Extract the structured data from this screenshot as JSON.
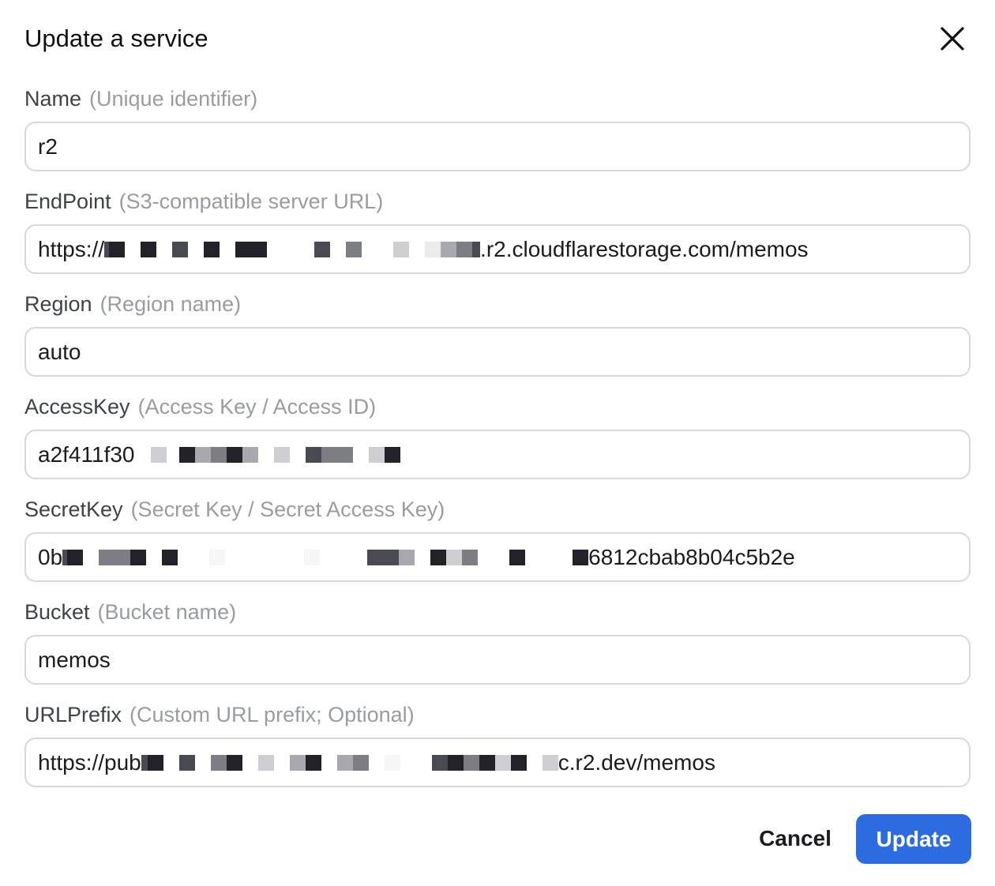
{
  "dialog": {
    "title": "Update a service",
    "close_icon": "close-icon"
  },
  "fields": {
    "name": {
      "label": "Name",
      "hint": "(Unique identifier)",
      "value": "r2"
    },
    "endpoint": {
      "label": "EndPoint",
      "hint": "(S3-compatible server URL)",
      "value_start": "https://",
      "value_end": ".r2.cloudflarestorage.com/memos"
    },
    "region": {
      "label": "Region",
      "hint": "(Region name)",
      "value": "auto"
    },
    "access_key": {
      "label": "AccessKey",
      "hint": "(Access Key / Access ID)",
      "value_start": "a2f411f30"
    },
    "secret_key": {
      "label": "SecretKey",
      "hint": "(Secret Key / Secret Access Key)",
      "value_start": "0b",
      "value_end": "6812cbab8b04c5b2e"
    },
    "bucket": {
      "label": "Bucket",
      "hint": "(Bucket name)",
      "value": "memos"
    },
    "url_prefix": {
      "label": "URLPrefix",
      "hint": "(Custom URL prefix; Optional)",
      "value_start": "https://pub",
      "value_end": "c.r2.dev/memos"
    }
  },
  "footer": {
    "cancel_label": "Cancel",
    "update_label": "Update"
  },
  "colors": {
    "primary_button": "#2d6be0",
    "hint_text": "#9a9ba3",
    "border": "#d7d8dd"
  }
}
